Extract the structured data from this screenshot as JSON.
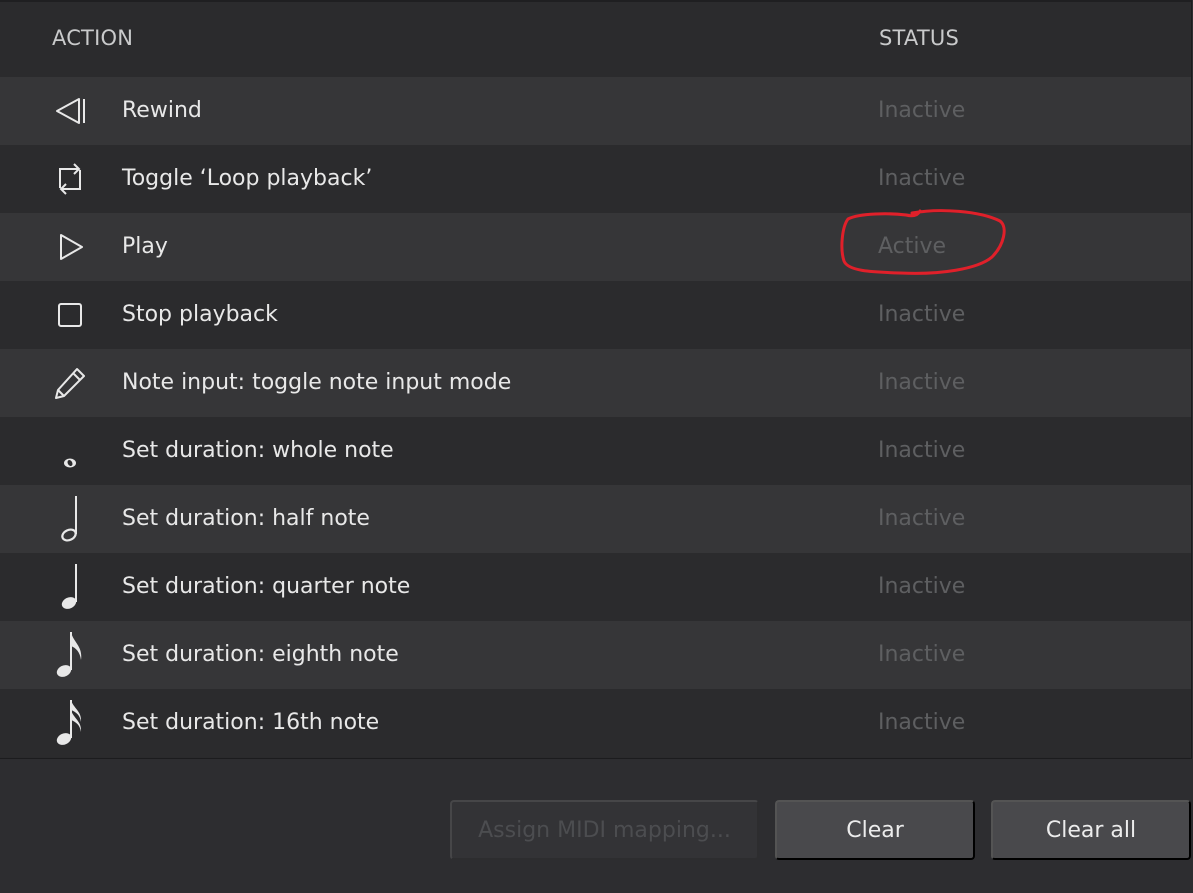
{
  "table": {
    "columns": {
      "action": "ACTION",
      "status": "STATUS"
    },
    "rows": [
      {
        "icon": "rewind-icon",
        "label": "Rewind",
        "status": "Inactive"
      },
      {
        "icon": "loop-icon",
        "label": "Toggle ‘Loop playback’",
        "status": "Inactive"
      },
      {
        "icon": "play-icon",
        "label": "Play",
        "status": "Active"
      },
      {
        "icon": "stop-icon",
        "label": "Stop playback",
        "status": "Inactive"
      },
      {
        "icon": "pencil-icon",
        "label": "Note input: toggle note input mode",
        "status": "Inactive"
      },
      {
        "icon": "whole-note-icon",
        "label": "Set duration: whole note",
        "status": "Inactive"
      },
      {
        "icon": "half-note-icon",
        "label": "Set duration: half note",
        "status": "Inactive"
      },
      {
        "icon": "quarter-note-icon",
        "label": "Set duration: quarter note",
        "status": "Inactive"
      },
      {
        "icon": "eighth-note-icon",
        "label": "Set duration: eighth note",
        "status": "Inactive"
      },
      {
        "icon": "sixteenth-note-icon",
        "label": "Set duration: 16th note",
        "status": "Inactive"
      }
    ]
  },
  "buttons": {
    "assign": "Assign MIDI mapping...",
    "clear": "Clear",
    "clear_all": "Clear all"
  },
  "colors": {
    "annotation": "#e0202a",
    "status_text": "#5e5f61",
    "row_even": "#363638",
    "row_odd": "#2b2b2d"
  }
}
